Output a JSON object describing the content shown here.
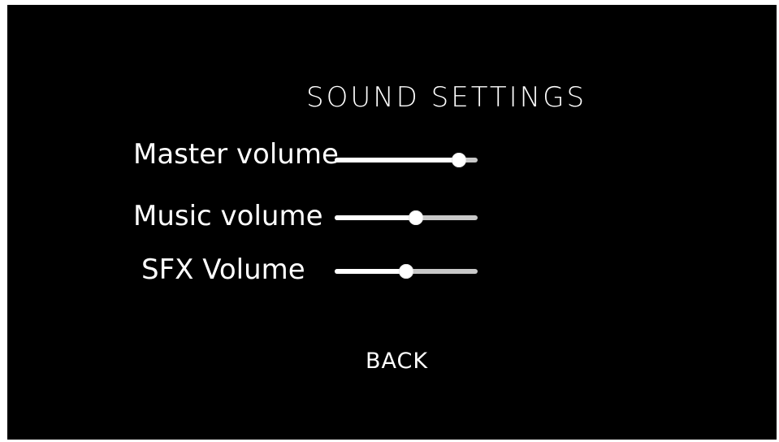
{
  "title": "SOUND SETTINGS",
  "settings": [
    {
      "label": "Master volume",
      "value": 0.87
    },
    {
      "label": "Music volume",
      "value": 0.57
    },
    {
      "label": "SFX Volume",
      "value": 0.5
    }
  ],
  "back_label": "BACK",
  "colors": {
    "background": "#000000",
    "text": "#ffffff",
    "track": "#c8c8c8",
    "fill": "#ffffff"
  }
}
